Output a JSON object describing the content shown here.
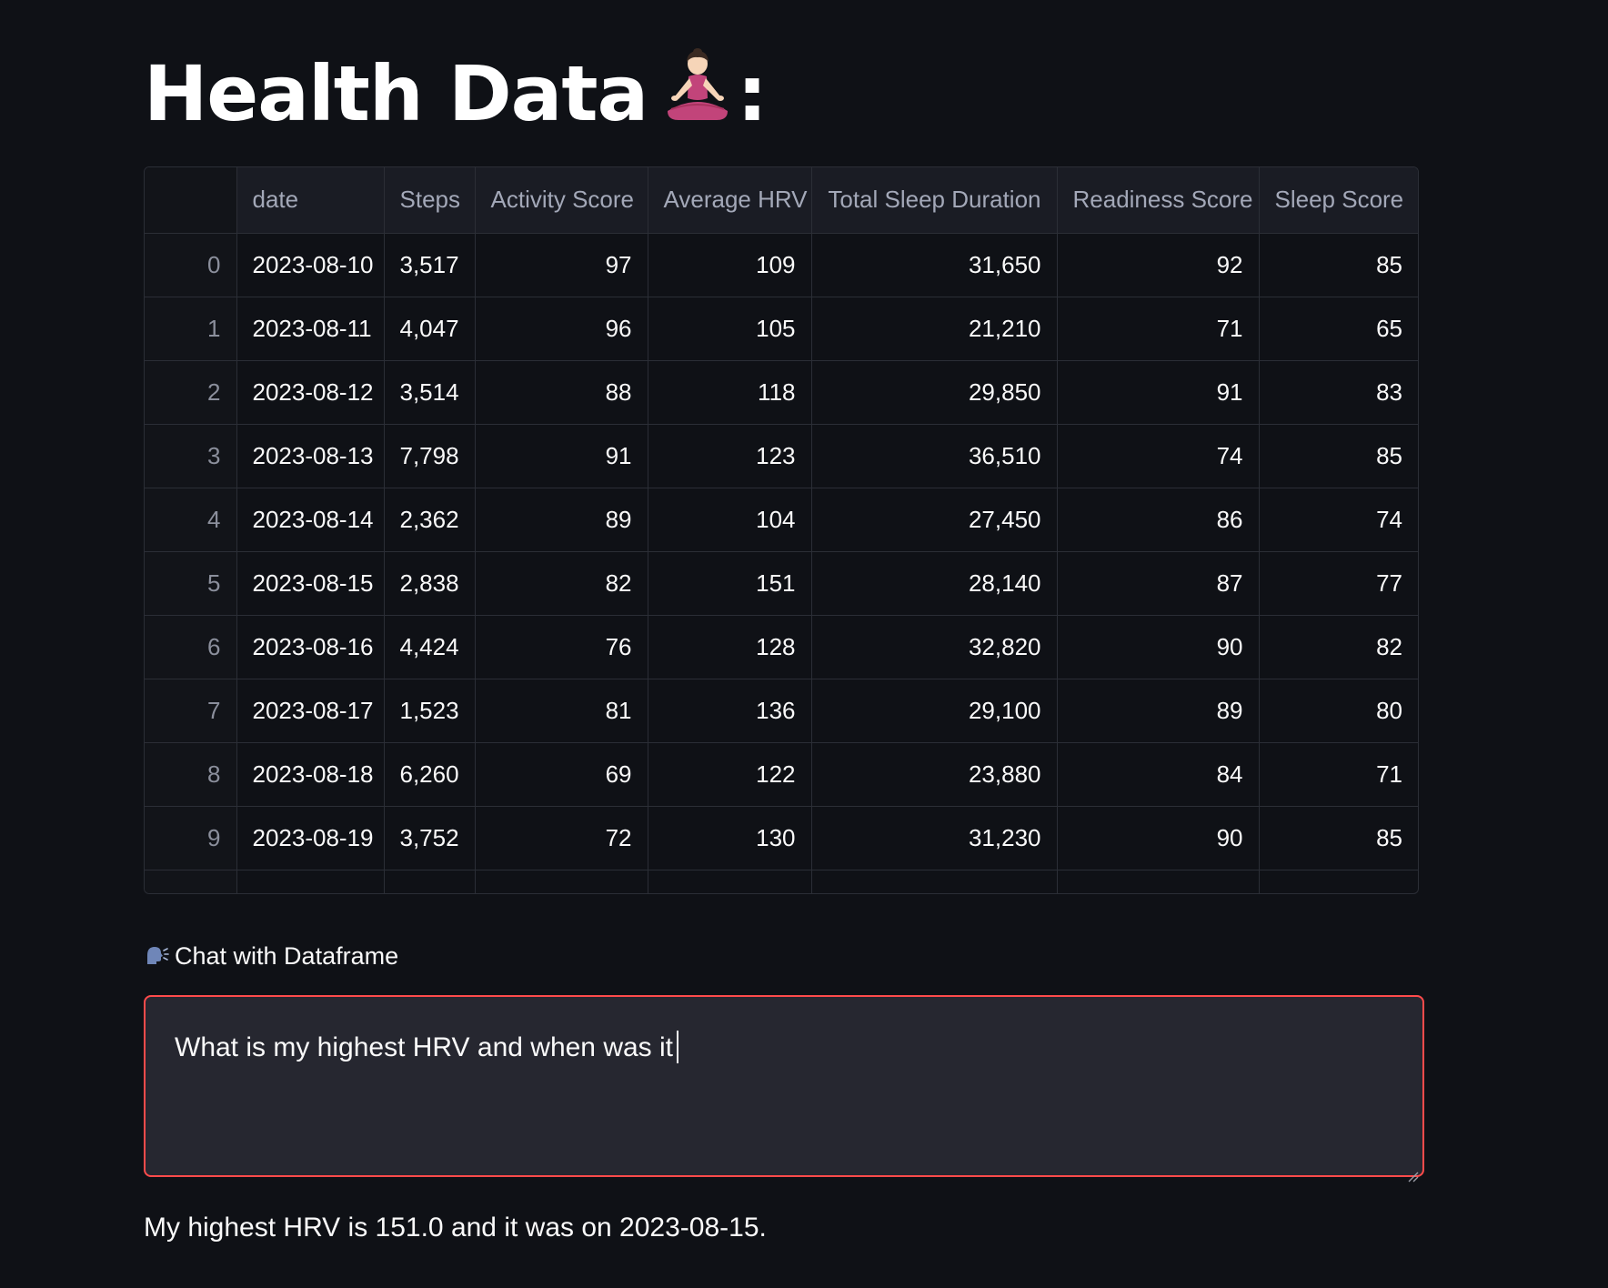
{
  "header": {
    "title": "Health Data",
    "title_suffix": ":",
    "title_icon": "yoga-person-icon"
  },
  "dataframe": {
    "columns": [
      "",
      "date",
      "Steps",
      "Activity Score",
      "Average HRV",
      "Total Sleep Duration",
      "Readiness Score",
      "Sleep Score"
    ],
    "rows": [
      [
        "0",
        "2023-08-10",
        "3,517",
        "97",
        "109",
        "31,650",
        "92",
        "85"
      ],
      [
        "1",
        "2023-08-11",
        "4,047",
        "96",
        "105",
        "21,210",
        "71",
        "65"
      ],
      [
        "2",
        "2023-08-12",
        "3,514",
        "88",
        "118",
        "29,850",
        "91",
        "83"
      ],
      [
        "3",
        "2023-08-13",
        "7,798",
        "91",
        "123",
        "36,510",
        "74",
        "85"
      ],
      [
        "4",
        "2023-08-14",
        "2,362",
        "89",
        "104",
        "27,450",
        "86",
        "74"
      ],
      [
        "5",
        "2023-08-15",
        "2,838",
        "82",
        "151",
        "28,140",
        "87",
        "77"
      ],
      [
        "6",
        "2023-08-16",
        "4,424",
        "76",
        "128",
        "32,820",
        "90",
        "82"
      ],
      [
        "7",
        "2023-08-17",
        "1,523",
        "81",
        "136",
        "29,100",
        "89",
        "80"
      ],
      [
        "8",
        "2023-08-18",
        "6,260",
        "69",
        "122",
        "23,880",
        "84",
        "71"
      ],
      [
        "9",
        "2023-08-19",
        "3,752",
        "72",
        "130",
        "31,230",
        "90",
        "85"
      ]
    ]
  },
  "chat": {
    "label": "Chat with Dataframe",
    "label_icon": "speaking-head-icon",
    "input_value": "What is my highest HRV and when was it",
    "accent_color": "#ff4b4b"
  },
  "answer": {
    "text": "My highest HRV is 151.0 and it was on 2023-08-15."
  }
}
